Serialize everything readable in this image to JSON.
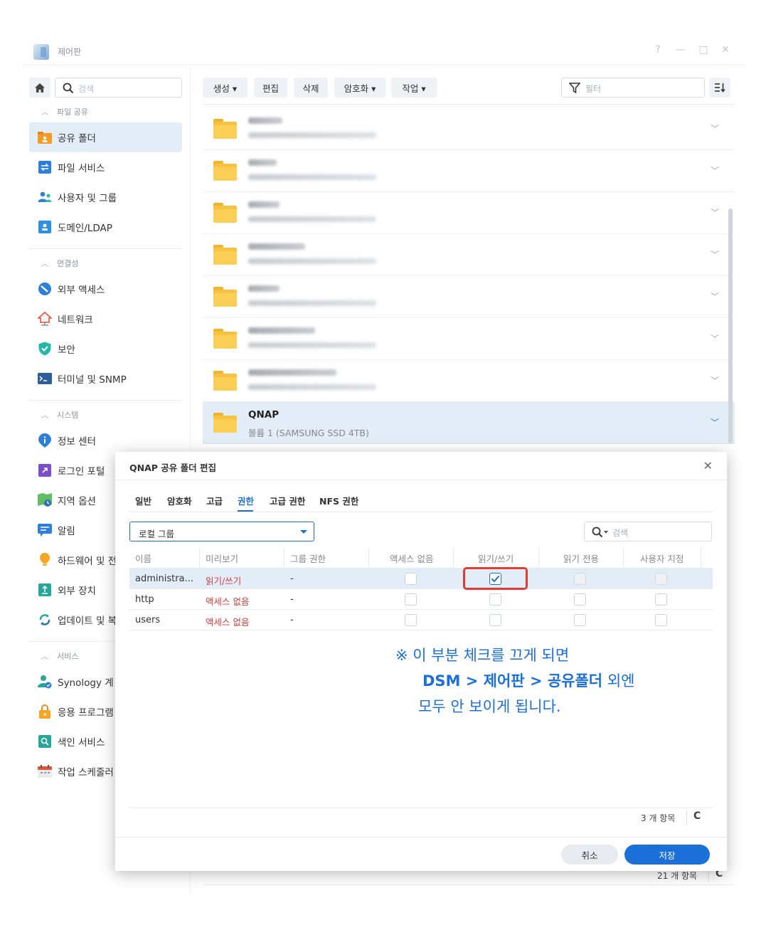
{
  "window": {
    "title": "제어판",
    "controls": [
      "?",
      "—",
      "□",
      "✕"
    ]
  },
  "sidebar": {
    "search_placeholder": "검색",
    "sections": [
      {
        "label": "파일 공유",
        "items": [
          {
            "label": "공유 폴더",
            "icon": "shared-folder-icon",
            "active": true
          },
          {
            "label": "파일 서비스",
            "icon": "file-services-icon"
          },
          {
            "label": "사용자 및 그룹",
            "icon": "users-groups-icon"
          },
          {
            "label": "도메인/LDAP",
            "icon": "domain-ldap-icon"
          }
        ]
      },
      {
        "label": "연결성",
        "items": [
          {
            "label": "외부 액세스",
            "icon": "external-access-icon"
          },
          {
            "label": "네트워크",
            "icon": "network-icon"
          },
          {
            "label": "보안",
            "icon": "security-shield-icon"
          },
          {
            "label": "터미널 및 SNMP",
            "icon": "terminal-icon"
          }
        ]
      },
      {
        "label": "시스템",
        "items": [
          {
            "label": "정보 센터",
            "icon": "info-center-icon"
          },
          {
            "label": "로그인 포털",
            "icon": "login-portal-icon"
          },
          {
            "label": "지역 옵션",
            "icon": "regional-options-icon"
          },
          {
            "label": "알림",
            "icon": "notification-icon"
          },
          {
            "label": "하드웨어 및 전",
            "icon": "hardware-power-icon"
          },
          {
            "label": "외부 장치",
            "icon": "external-devices-icon"
          },
          {
            "label": "업데이트 및 복",
            "icon": "update-restore-icon"
          }
        ]
      },
      {
        "label": "서비스",
        "items": [
          {
            "label": "Synology 계",
            "icon": "synology-account-icon"
          },
          {
            "label": "응용 프로그램",
            "icon": "application-privileges-icon"
          },
          {
            "label": "색인 서비스",
            "icon": "indexing-service-icon"
          },
          {
            "label": "작업 스케줄러",
            "icon": "task-scheduler-icon"
          }
        ]
      }
    ]
  },
  "toolbar": {
    "create": "생성 ▾",
    "edit": "편집",
    "delete": "삭제",
    "encrypt": "암호화 ▾",
    "action": "작업 ▾",
    "filter_placeholder": "필터"
  },
  "folders": {
    "selected": {
      "name": "QNAP",
      "volume": "볼륨 1 (SAMSUNG SSD 4TB)"
    }
  },
  "main_status": {
    "count": "21 개 항목",
    "refresh": "C"
  },
  "dialog": {
    "title": "QNAP 공유 폴더 편집",
    "close": "✕",
    "tabs": [
      "일반",
      "암호화",
      "고급",
      "권한",
      "고급 권한",
      "NFS 권한"
    ],
    "active_tab": "권한",
    "group_select": "로컬 그룹",
    "search_placeholder": "검색",
    "columns": [
      "이름",
      "미리보기",
      "그룹 권한",
      "액세스 없음",
      "읽기/쓰기",
      "읽기 전용",
      "사용자 지정"
    ],
    "rows": [
      {
        "name": "administra...",
        "preview": "읽기/쓰기",
        "group_perm": "-",
        "no_access": false,
        "read_write": true,
        "read_only": false,
        "custom": false
      },
      {
        "name": "http",
        "preview": "액세스 없음",
        "group_perm": "-",
        "no_access": false,
        "read_write": false,
        "read_only": false,
        "custom": false
      },
      {
        "name": "users",
        "preview": "액세스 없음",
        "group_perm": "-",
        "no_access": false,
        "read_write": false,
        "read_only": false,
        "custom": false
      }
    ],
    "annotation": {
      "line1": "※ 이 부분 체크를 끄게 되면",
      "line2_bold": "DSM > 제어판 > 공유폴더",
      "line2_rest": " 외엔",
      "line3": "모두 안 보이게 됩니다."
    },
    "status": "3 개 항목",
    "refresh": "C",
    "cancel": "취소",
    "save": "저장"
  },
  "colors": {
    "accent": "#1a6fd8",
    "selected_bg": "#e3edf8",
    "danger_text": "#d33c3c",
    "highlight_box": "#e33b2e",
    "folder": "#f7c243"
  }
}
